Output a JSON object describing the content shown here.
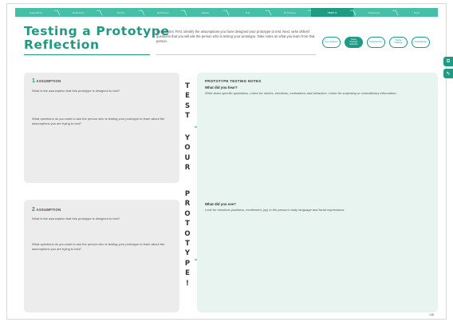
{
  "nav": {
    "steps": [
      "Empathize",
      "Reflection",
      "Define",
      "Reflection",
      "Ideate",
      "Test",
      "Prototype",
      "Test",
      "Reflection",
      "Final"
    ],
    "active_index": 7,
    "active_label": "TEST 2"
  },
  "title": {
    "line1": "Testing a Prototype",
    "line2": "Reflection"
  },
  "instructions": "Instructions: First, identify the assumptions you have designed your prototype to test. Next, write debrief questions that you will ask the person who is testing your prototype. Take notes on what you learn from that person.",
  "subnav": {
    "items": [
      "Test 1 Reflection",
      "Testing Prototype Reflection",
      "Reflection Prep",
      "Practice Challenge",
      "Final Reflection"
    ],
    "active_index": 1
  },
  "side_tabs": [
    "link-icon",
    "pencil-icon"
  ],
  "left_panels": [
    {
      "number": "1",
      "label": "ASSUMPTION",
      "q1": "What is the assumption that this prototype is designed to test?",
      "q2": "What questions do you want to ask the person who is testing your prototype to learn about the assumptions you are trying to test?"
    },
    {
      "number": "2",
      "label": "ASSUMPTION",
      "q1": "What is the assumption that this prototype is designed to test?",
      "q2": "What questions do you want to ask the person who is testing your prototype to learn about the assumptions you are trying to test?"
    }
  ],
  "vertical_text": {
    "top_letters": [
      "T",
      "E",
      "S",
      "T"
    ],
    "middle_letters": [
      "Y",
      "O",
      "U",
      "R"
    ],
    "bottom_letters": [
      "P",
      "R",
      "O",
      "T",
      "O",
      "T",
      "Y",
      "P",
      "E",
      "!"
    ]
  },
  "notes": {
    "title": "PROTOTYPE TESTING NOTES",
    "section1_head": "What did you hear?",
    "section1_body": "Write down specific quotations. Listen for stories, emotions, motivations and behaviors. Listen for surprising or contradictory information.",
    "section2_head": "What did you see?",
    "section2_body": "Look for emotions (sadness, excitement, joy) in the person's body language and facial expressions."
  },
  "page_number": "148",
  "colors": {
    "brand_teal": "#1f9a83",
    "nav_teal": "#45bfa5",
    "panel_gray": "#ececec",
    "notes_mint": "#e7f4ef"
  }
}
